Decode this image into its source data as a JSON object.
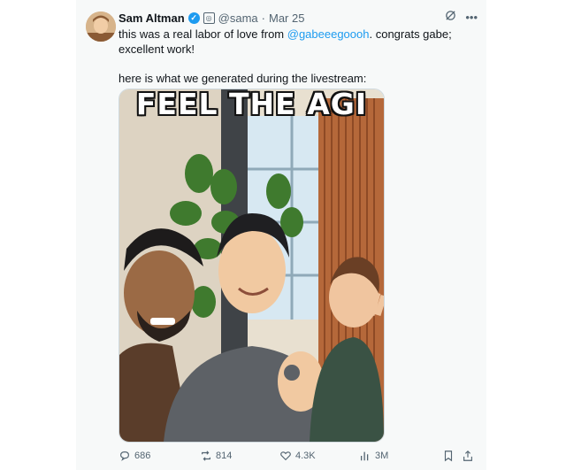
{
  "tweet": {
    "author_name": "Sam Altman",
    "handle": "@sama",
    "separator": "·",
    "date": "Mar 25",
    "text_before_mention": "this was a real labor of love from ",
    "mention": "@gabeeegoooh",
    "text_after_mention": ". congrats gabe; excellent work!",
    "second_paragraph": "here is what we generated during the livestream:",
    "media": {
      "caption": "FEEL THE AGI"
    },
    "actions": {
      "replies": "686",
      "reposts": "814",
      "likes": "4.3K",
      "views": "3M"
    }
  },
  "colors": {
    "accent": "#1d9bf0",
    "secondary_text": "#536471",
    "card_background": "#f7f9f9"
  },
  "icons": {
    "verified": "verified-badge-icon",
    "affiliation": "affiliation-icon",
    "grok": "grok-icon",
    "more": "more-icon",
    "reply": "reply-icon",
    "repost": "repost-icon",
    "like": "like-icon",
    "views": "views-icon",
    "bookmark": "bookmark-icon",
    "share": "share-icon"
  }
}
